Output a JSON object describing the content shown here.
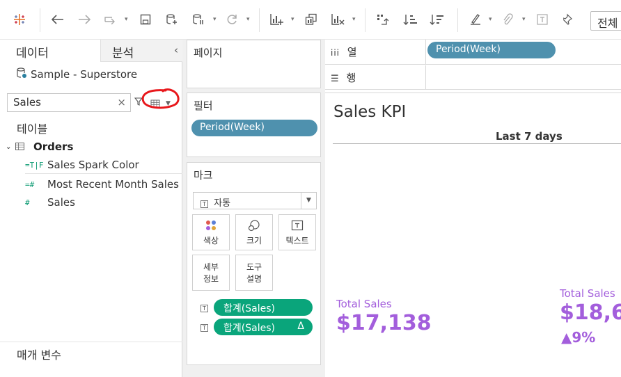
{
  "toolbar": {
    "fit_label": "전체"
  },
  "data_pane": {
    "tab_data": "데이터",
    "tab_analysis": "분석",
    "datasource": "Sample - Superstore",
    "search_value": "Sales",
    "tables_header": "테이블",
    "table_name": "Orders",
    "fields": [
      {
        "type": "=T|F",
        "name": "Sales Spark Color"
      },
      {
        "type": "=#",
        "name": "Most Recent Month Sales"
      },
      {
        "type": "#",
        "name": "Sales"
      }
    ],
    "parameters_header": "매개 변수"
  },
  "shelves": {
    "pages_title": "페이지",
    "filters_title": "필터",
    "filter_pill": "Period(Week)",
    "marks_title": "마크",
    "mark_type": "자동",
    "mark_buttons": {
      "color": "색상",
      "size": "크기",
      "text": "텍스트",
      "detail_line1": "세부",
      "detail_line2": "정보",
      "tooltip_line1": "도구",
      "tooltip_line2": "설명"
    },
    "mark_pills": [
      {
        "label": "합계(Sales)",
        "suffix": ""
      },
      {
        "label": "합계(Sales)",
        "suffix": "Δ"
      }
    ]
  },
  "view": {
    "columns_label": "열",
    "rows_label": "행",
    "columns_pill": "Period(Week)",
    "title": "Sales KPI",
    "subtitle": "Last 7 days",
    "kpi_left": {
      "label": "Total Sales",
      "value": "$17,138"
    },
    "kpi_right": {
      "label": "Total Sales",
      "value": "$18,6",
      "delta": "▲9%"
    }
  },
  "colors": {
    "accent_purple": "#a35edc",
    "pill_blue": "#4f91ae",
    "pill_green": "#0aa57b",
    "annotation_red": "#e8171b"
  }
}
